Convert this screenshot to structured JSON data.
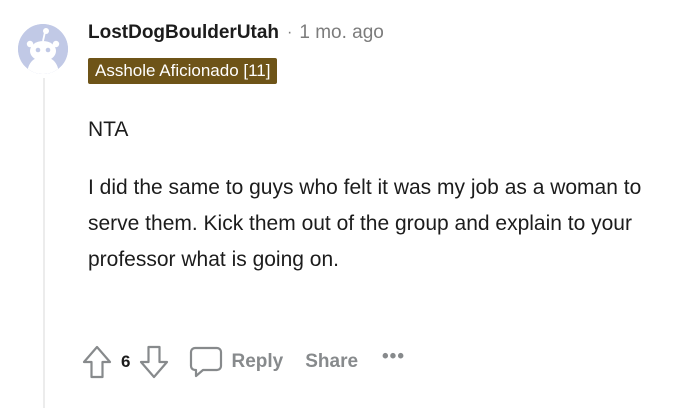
{
  "comment": {
    "author": "LostDogBoulderUtah",
    "separator": "·",
    "timestamp": "1 mo. ago",
    "flair": "Asshole Aficionado [11]",
    "paragraphs": [
      "NTA",
      "I did the same to guys who felt it was my job as a woman to serve them. Kick them out of the group and explain to your professor what is going on."
    ]
  },
  "actions": {
    "vote_count": "6",
    "reply_label": "Reply",
    "share_label": "Share",
    "more_label": "•••"
  },
  "icons": {
    "avatar": "reddit-snoo-avatar-icon",
    "upvote": "arrow-up-icon",
    "downvote": "arrow-down-icon",
    "reply": "speech-bubble-icon"
  },
  "colors": {
    "avatar_bg": "#c1c9e6",
    "flair_bg": "#6e5418",
    "muted_text": "#878a8c"
  }
}
